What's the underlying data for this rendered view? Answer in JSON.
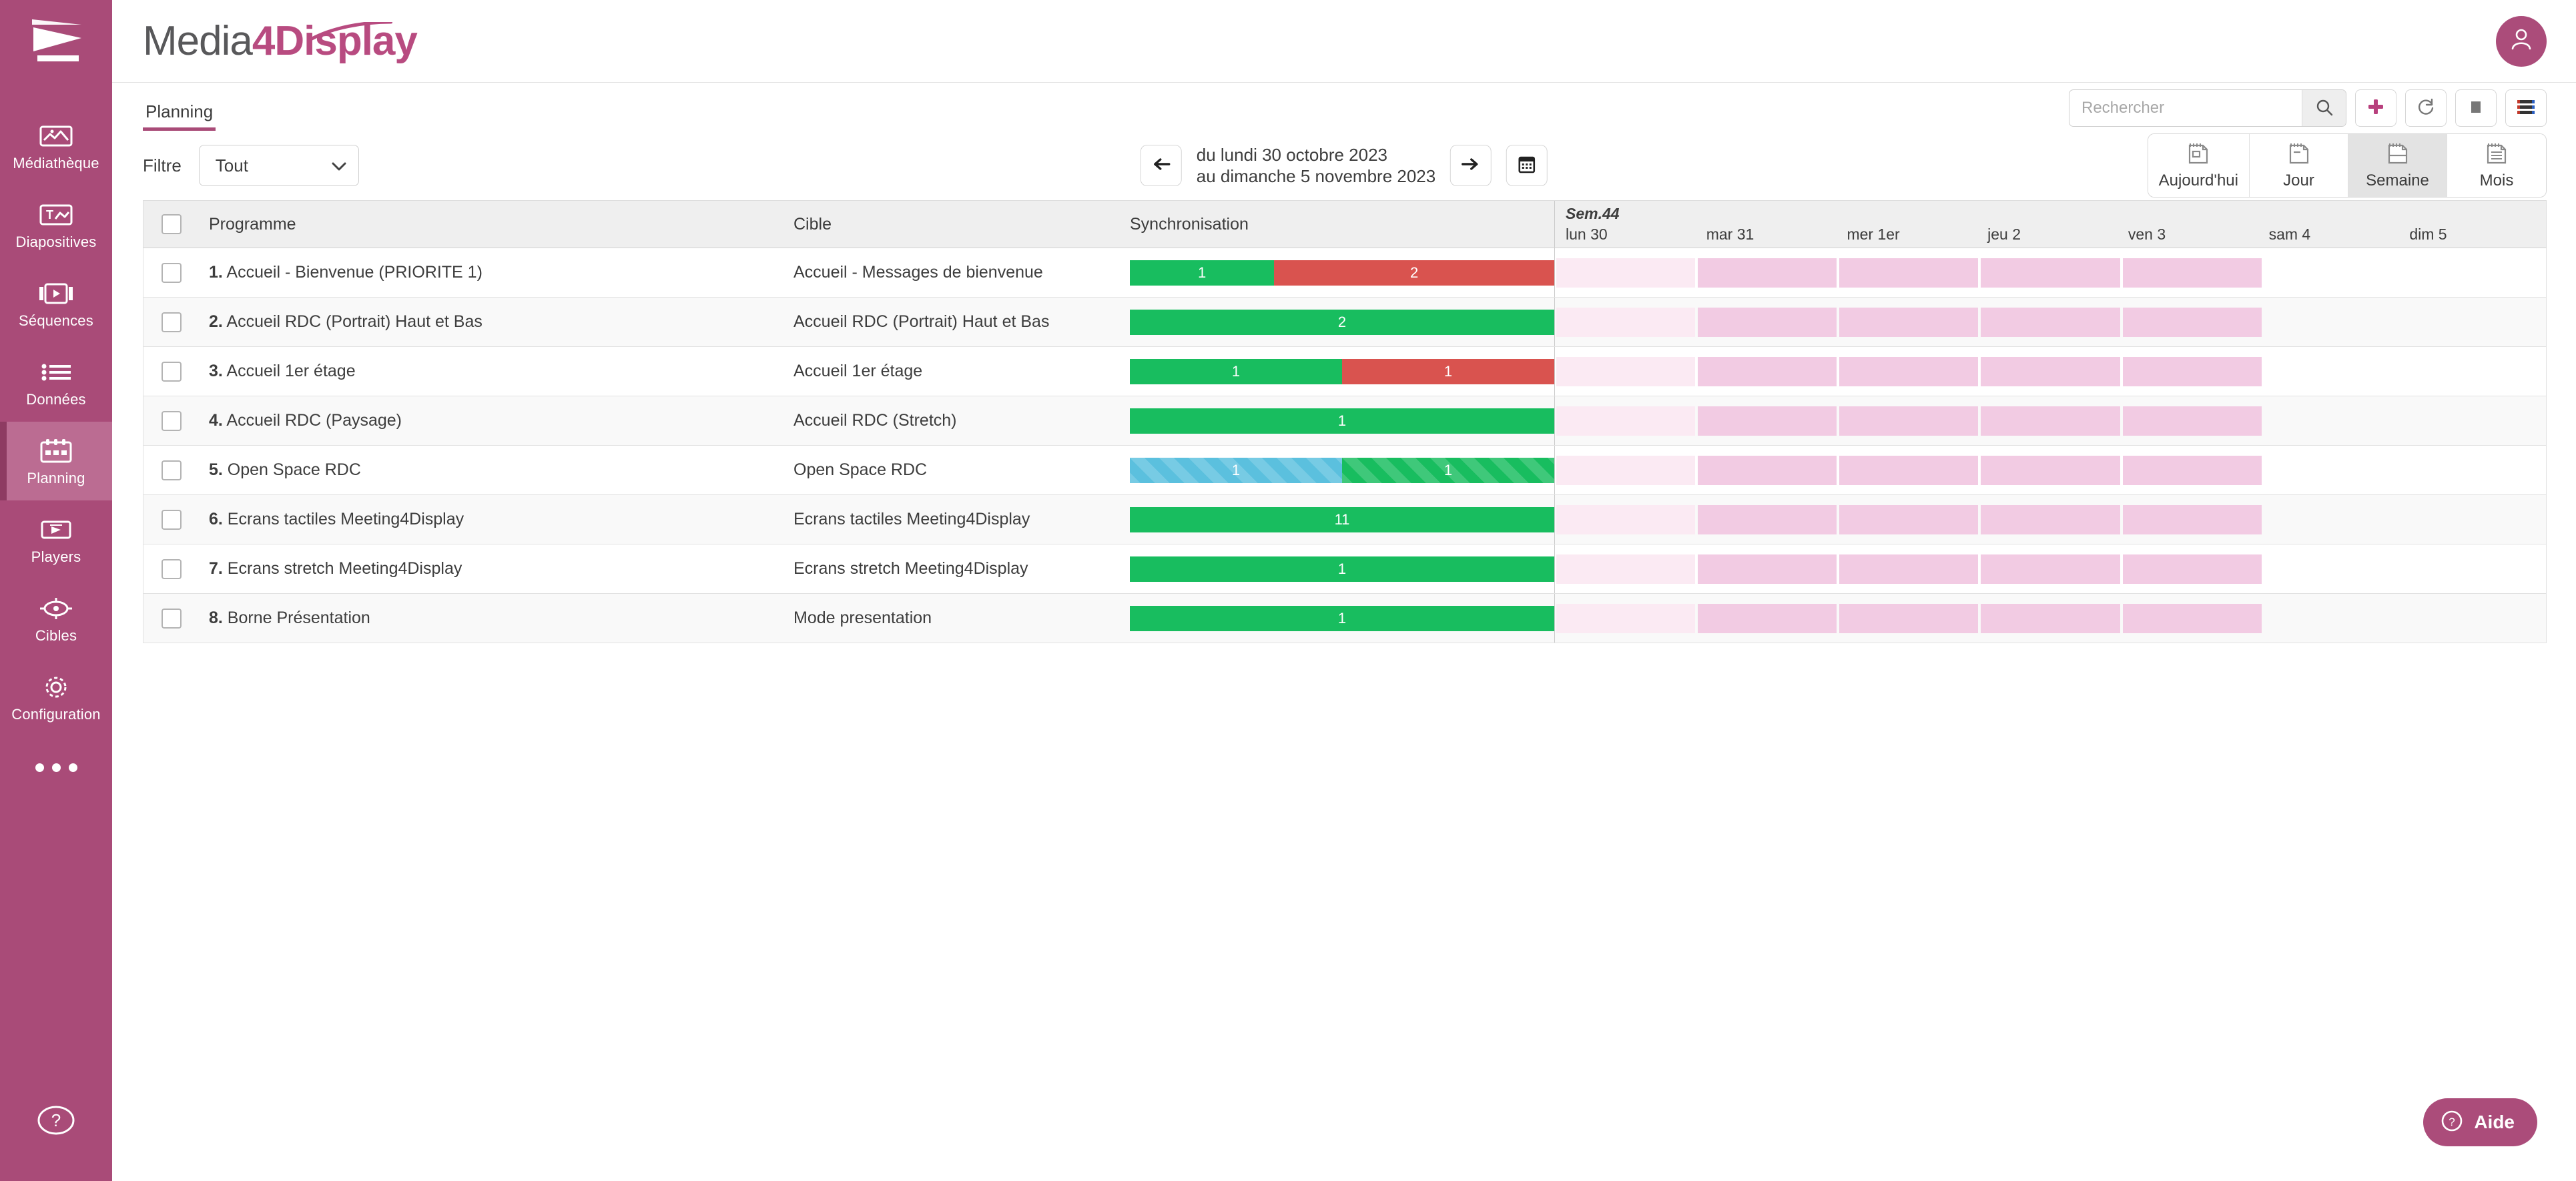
{
  "brand": {
    "part1": "Media",
    "part2": "4Display"
  },
  "sidebar": {
    "items": [
      {
        "label": "Médiathèque",
        "icon": "media-library-icon",
        "active": false
      },
      {
        "label": "Diapositives",
        "icon": "slides-icon",
        "active": false
      },
      {
        "label": "Séquences",
        "icon": "sequences-icon",
        "active": false
      },
      {
        "label": "Données",
        "icon": "data-icon",
        "active": false
      },
      {
        "label": "Planning",
        "icon": "planning-calendar-icon",
        "active": true
      },
      {
        "label": "Players",
        "icon": "players-icon",
        "active": false
      },
      {
        "label": "Cibles",
        "icon": "targets-icon",
        "active": false
      },
      {
        "label": "Configuration",
        "icon": "gear-icon",
        "active": false
      }
    ],
    "more_icon": "ellipsis-icon",
    "help_icon": "question-circle-icon"
  },
  "tabs": [
    {
      "label": "Planning",
      "active": true
    }
  ],
  "toolbar": {
    "search_placeholder": "Rechercher",
    "search_value": "",
    "search_icon": "magnifier-icon",
    "add_icon": "plus-icon",
    "refresh_icon": "refresh-icon",
    "stop_icon": "stop-square-icon",
    "menu_icon": "list-menu-icon"
  },
  "filter": {
    "label": "Filtre",
    "value": "Tout",
    "chevron_icon": "chevron-down-icon"
  },
  "daterange": {
    "prev_icon": "arrow-left-icon",
    "next_icon": "arrow-right-icon",
    "calendar_icon": "calendar-icon",
    "line1": "du lundi 30 octobre 2023",
    "line2": "au dimanche 5 novembre 2023"
  },
  "views": [
    {
      "label": "Aujourd'hui",
      "icon": "calendar-today-icon",
      "active": false
    },
    {
      "label": "Jour",
      "icon": "calendar-day-icon",
      "active": false
    },
    {
      "label": "Semaine",
      "icon": "calendar-week-icon",
      "active": true
    },
    {
      "label": "Mois",
      "icon": "calendar-month-icon",
      "active": false
    }
  ],
  "grid": {
    "headers": {
      "programme": "Programme",
      "cible": "Cible",
      "synchronisation": "Synchronisation",
      "week": "Sem.44",
      "days": [
        "lun 30",
        "mar 31",
        "mer 1er",
        "jeu 2",
        "ven 3",
        "sam 4",
        "dim 5"
      ]
    },
    "rows": [
      {
        "num": "1.",
        "programme": "Accueil - Bienvenue (PRIORITE 1)",
        "cible": "Accueil - Messages de bienvenue",
        "sync": [
          {
            "type": "green",
            "value": "1",
            "pct": 34
          },
          {
            "type": "red",
            "value": "2",
            "pct": 66
          }
        ],
        "days": [
          "light",
          "solid",
          "solid",
          "solid",
          "solid",
          "none",
          "none"
        ]
      },
      {
        "num": "2.",
        "programme": "Accueil RDC (Portrait) Haut et Bas",
        "cible": "Accueil RDC (Portrait) Haut et Bas",
        "sync": [
          {
            "type": "green",
            "value": "2",
            "pct": 100
          }
        ],
        "days": [
          "light",
          "solid",
          "solid",
          "solid",
          "solid",
          "none",
          "none"
        ]
      },
      {
        "num": "3.",
        "programme": "Accueil 1er étage",
        "cible": "Accueil 1er étage",
        "sync": [
          {
            "type": "green",
            "value": "1",
            "pct": 50
          },
          {
            "type": "red",
            "value": "1",
            "pct": 50
          }
        ],
        "days": [
          "light",
          "solid",
          "solid",
          "solid",
          "solid",
          "none",
          "none"
        ]
      },
      {
        "num": "4.",
        "programme": "Accueil RDC (Paysage)",
        "cible": "Accueil RDC (Stretch)",
        "sync": [
          {
            "type": "green",
            "value": "1",
            "pct": 100
          }
        ],
        "days": [
          "light",
          "solid",
          "solid",
          "solid",
          "solid",
          "none",
          "none"
        ]
      },
      {
        "num": "5.",
        "programme": "Open Space RDC",
        "cible": "Open Space RDC",
        "sync": [
          {
            "type": "striped-blue",
            "value": "1",
            "pct": 50
          },
          {
            "type": "striped-green",
            "value": "1",
            "pct": 50
          }
        ],
        "days": [
          "light",
          "solid",
          "solid",
          "solid",
          "solid",
          "none",
          "none"
        ]
      },
      {
        "num": "6.",
        "programme": "Ecrans tactiles Meeting4Display",
        "cible": "Ecrans tactiles Meeting4Display",
        "sync": [
          {
            "type": "green",
            "value": "11",
            "pct": 100
          }
        ],
        "days": [
          "light",
          "solid",
          "solid",
          "solid",
          "solid",
          "none",
          "none"
        ]
      },
      {
        "num": "7.",
        "programme": "Ecrans stretch Meeting4Display",
        "cible": "Ecrans stretch Meeting4Display",
        "sync": [
          {
            "type": "green",
            "value": "1",
            "pct": 100
          }
        ],
        "days": [
          "light",
          "solid",
          "solid",
          "solid",
          "solid",
          "none",
          "none"
        ]
      },
      {
        "num": "8.",
        "programme": "Borne Présentation",
        "cible": "Mode presentation",
        "sync": [
          {
            "type": "green",
            "value": "1",
            "pct": 100
          }
        ],
        "days": [
          "light",
          "solid",
          "solid",
          "solid",
          "solid",
          "none",
          "none"
        ]
      }
    ]
  },
  "help_fab": {
    "label": "Aide",
    "icon": "question-circle-icon"
  },
  "colors": {
    "brand_pink": "#a94b78",
    "brand_pink_dark": "#8e3b62",
    "logo_pink": "#b84b80",
    "green": "#18bd5f",
    "red": "#d9534f",
    "blue": "#5bc0de",
    "cal_light": "#fbeaf3",
    "cal_solid": "#f2cbe3"
  }
}
